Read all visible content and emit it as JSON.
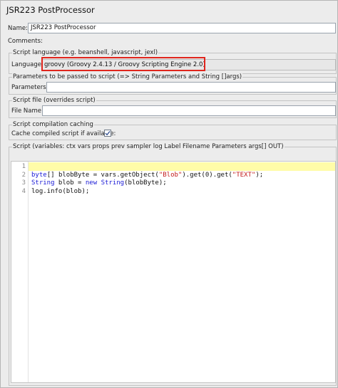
{
  "header": {
    "title": "JSR223 PostProcessor"
  },
  "name_field": {
    "label": "Name:",
    "value": "JSR223 PostProcessor"
  },
  "comments_field": {
    "label": "Comments:"
  },
  "script_language": {
    "group_title": "Script language (e.g. beanshell, javascript, jexl)",
    "label": "Language:",
    "selected": "groovy     (Groovy 2.4.13 / Groovy Scripting Engine 2.0)"
  },
  "parameters": {
    "group_title": "Parameters to be passed to script (=> String Parameters and String []args)",
    "label": "Parameters:"
  },
  "script_file": {
    "group_title": "Script file (overrides script)",
    "label": "File Name:"
  },
  "compilation": {
    "group_title": "Script compilation caching",
    "label": "Cache compiled script if available:",
    "checked": true
  },
  "script": {
    "group_title": "Script (variables: ctx vars props prev sampler log Label Filename Parameters args[] OUT)",
    "lines": [
      {
        "num": "1",
        "tokens": []
      },
      {
        "num": "2",
        "tokens": [
          {
            "t": "kw",
            "v": "byte"
          },
          {
            "t": "plain",
            "v": "[] blobByte = vars.getObject("
          },
          {
            "t": "str",
            "v": "\"Blob\""
          },
          {
            "t": "plain",
            "v": ").get("
          },
          {
            "t": "num",
            "v": "0"
          },
          {
            "t": "plain",
            "v": ").get("
          },
          {
            "t": "str",
            "v": "\"TEXT\""
          },
          {
            "t": "plain",
            "v": ");"
          }
        ]
      },
      {
        "num": "3",
        "tokens": [
          {
            "t": "kw",
            "v": "String"
          },
          {
            "t": "plain",
            "v": " blob = "
          },
          {
            "t": "kw",
            "v": "new"
          },
          {
            "t": "plain",
            "v": " "
          },
          {
            "t": "kw",
            "v": "String"
          },
          {
            "t": "plain",
            "v": "(blobByte);"
          }
        ]
      },
      {
        "num": "4",
        "tokens": [
          {
            "t": "plain",
            "v": "log.info(blob);"
          }
        ]
      }
    ]
  },
  "colors": {
    "highlight_border": "#e0251c",
    "current_line": "#fffca8",
    "keyword": "#1a1ad6",
    "string": "#c21a1a"
  },
  "icons": {
    "checkbox_mark": "check-icon"
  }
}
